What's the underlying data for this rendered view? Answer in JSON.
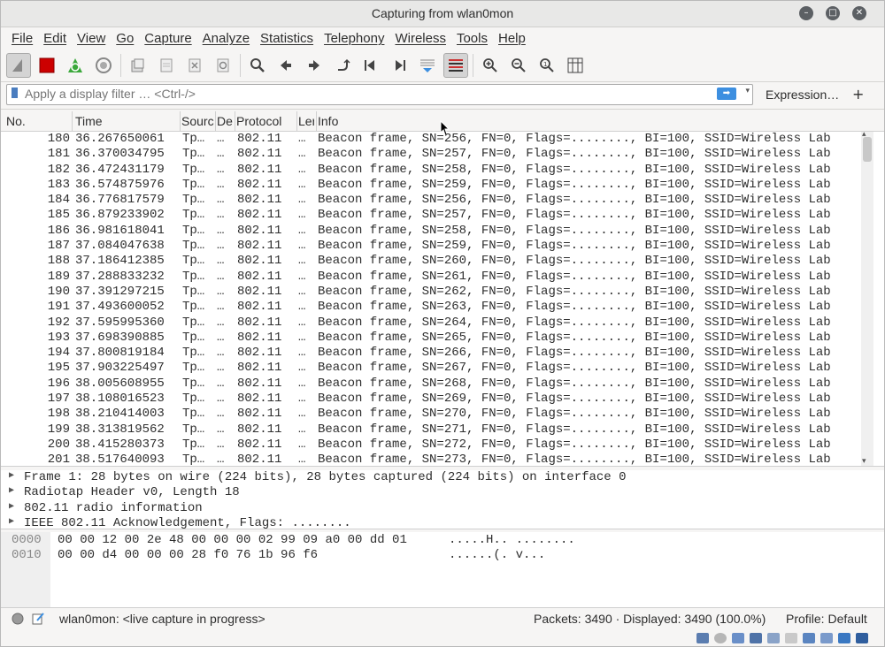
{
  "window": {
    "title": "Capturing from wlan0mon"
  },
  "menubar": [
    "File",
    "Edit",
    "View",
    "Go",
    "Capture",
    "Analyze",
    "Statistics",
    "Telephony",
    "Wireless",
    "Tools",
    "Help"
  ],
  "filter": {
    "placeholder": "Apply a display filter … <Ctrl-/>",
    "expression_label": "Expression…",
    "plus_label": "+"
  },
  "columns": [
    "No.",
    "Time",
    "Source",
    "Destination",
    "Protocol",
    "Length",
    "Info"
  ],
  "column_display": [
    "No.",
    "Time",
    "Sourc",
    "De",
    "Protocol",
    "Ler",
    "Info"
  ],
  "packets": [
    {
      "no": "180",
      "time": "36.267650061",
      "src": "Tp…",
      "dst": "…",
      "proto": "802.11",
      "len": "…",
      "info": "Beacon frame, SN=256, FN=0, Flags=........, BI=100, SSID=Wireless Lab"
    },
    {
      "no": "181",
      "time": "36.370034795",
      "src": "Tp…",
      "dst": "…",
      "proto": "802.11",
      "len": "…",
      "info": "Beacon frame, SN=257, FN=0, Flags=........, BI=100, SSID=Wireless Lab"
    },
    {
      "no": "182",
      "time": "36.472431179",
      "src": "Tp…",
      "dst": "…",
      "proto": "802.11",
      "len": "…",
      "info": "Beacon frame, SN=258, FN=0, Flags=........, BI=100, SSID=Wireless Lab"
    },
    {
      "no": "183",
      "time": "36.574875976",
      "src": "Tp…",
      "dst": "…",
      "proto": "802.11",
      "len": "…",
      "info": "Beacon frame, SN=259, FN=0, Flags=........, BI=100, SSID=Wireless Lab"
    },
    {
      "no": "184",
      "time": "36.776817579",
      "src": "Tp…",
      "dst": "…",
      "proto": "802.11",
      "len": "…",
      "info": "Beacon frame, SN=256, FN=0, Flags=........, BI=100, SSID=Wireless Lab"
    },
    {
      "no": "185",
      "time": "36.879233902",
      "src": "Tp…",
      "dst": "…",
      "proto": "802.11",
      "len": "…",
      "info": "Beacon frame, SN=257, FN=0, Flags=........, BI=100, SSID=Wireless Lab"
    },
    {
      "no": "186",
      "time": "36.981618041",
      "src": "Tp…",
      "dst": "…",
      "proto": "802.11",
      "len": "…",
      "info": "Beacon frame, SN=258, FN=0, Flags=........, BI=100, SSID=Wireless Lab"
    },
    {
      "no": "187",
      "time": "37.084047638",
      "src": "Tp…",
      "dst": "…",
      "proto": "802.11",
      "len": "…",
      "info": "Beacon frame, SN=259, FN=0, Flags=........, BI=100, SSID=Wireless Lab"
    },
    {
      "no": "188",
      "time": "37.186412385",
      "src": "Tp…",
      "dst": "…",
      "proto": "802.11",
      "len": "…",
      "info": "Beacon frame, SN=260, FN=0, Flags=........, BI=100, SSID=Wireless Lab"
    },
    {
      "no": "189",
      "time": "37.288833232",
      "src": "Tp…",
      "dst": "…",
      "proto": "802.11",
      "len": "…",
      "info": "Beacon frame, SN=261, FN=0, Flags=........, BI=100, SSID=Wireless Lab"
    },
    {
      "no": "190",
      "time": "37.391297215",
      "src": "Tp…",
      "dst": "…",
      "proto": "802.11",
      "len": "…",
      "info": "Beacon frame, SN=262, FN=0, Flags=........, BI=100, SSID=Wireless Lab"
    },
    {
      "no": "191",
      "time": "37.493600052",
      "src": "Tp…",
      "dst": "…",
      "proto": "802.11",
      "len": "…",
      "info": "Beacon frame, SN=263, FN=0, Flags=........, BI=100, SSID=Wireless Lab"
    },
    {
      "no": "192",
      "time": "37.595995360",
      "src": "Tp…",
      "dst": "…",
      "proto": "802.11",
      "len": "…",
      "info": "Beacon frame, SN=264, FN=0, Flags=........, BI=100, SSID=Wireless Lab"
    },
    {
      "no": "193",
      "time": "37.698390885",
      "src": "Tp…",
      "dst": "…",
      "proto": "802.11",
      "len": "…",
      "info": "Beacon frame, SN=265, FN=0, Flags=........, BI=100, SSID=Wireless Lab"
    },
    {
      "no": "194",
      "time": "37.800819184",
      "src": "Tp…",
      "dst": "…",
      "proto": "802.11",
      "len": "…",
      "info": "Beacon frame, SN=266, FN=0, Flags=........, BI=100, SSID=Wireless Lab"
    },
    {
      "no": "195",
      "time": "37.903225497",
      "src": "Tp…",
      "dst": "…",
      "proto": "802.11",
      "len": "…",
      "info": "Beacon frame, SN=267, FN=0, Flags=........, BI=100, SSID=Wireless Lab"
    },
    {
      "no": "196",
      "time": "38.005608955",
      "src": "Tp…",
      "dst": "…",
      "proto": "802.11",
      "len": "…",
      "info": "Beacon frame, SN=268, FN=0, Flags=........, BI=100, SSID=Wireless Lab"
    },
    {
      "no": "197",
      "time": "38.108016523",
      "src": "Tp…",
      "dst": "…",
      "proto": "802.11",
      "len": "…",
      "info": "Beacon frame, SN=269, FN=0, Flags=........, BI=100, SSID=Wireless Lab"
    },
    {
      "no": "198",
      "time": "38.210414003",
      "src": "Tp…",
      "dst": "…",
      "proto": "802.11",
      "len": "…",
      "info": "Beacon frame, SN=270, FN=0, Flags=........, BI=100, SSID=Wireless Lab"
    },
    {
      "no": "199",
      "time": "38.313819562",
      "src": "Tp…",
      "dst": "…",
      "proto": "802.11",
      "len": "…",
      "info": "Beacon frame, SN=271, FN=0, Flags=........, BI=100, SSID=Wireless Lab"
    },
    {
      "no": "200",
      "time": "38.415280373",
      "src": "Tp…",
      "dst": "…",
      "proto": "802.11",
      "len": "…",
      "info": "Beacon frame, SN=272, FN=0, Flags=........, BI=100, SSID=Wireless Lab"
    },
    {
      "no": "201",
      "time": "38.517640093",
      "src": "Tp…",
      "dst": "…",
      "proto": "802.11",
      "len": "…",
      "info": "Beacon frame, SN=273, FN=0, Flags=........, BI=100, SSID=Wireless Lab"
    }
  ],
  "details": [
    "Frame 1: 28 bytes on wire (224 bits), 28 bytes captured (224 bits) on interface 0",
    "Radiotap Header v0, Length 18",
    "802.11 radio information",
    "IEEE 802.11 Acknowledgement, Flags: ........"
  ],
  "bytes": [
    {
      "offset": "0000",
      "hex": "00 00 12 00 2e 48 00 00  00 02 99 09 a0 00 dd 01",
      "ascii": ".....H.. ........"
    },
    {
      "offset": "0010",
      "hex": "00 00 d4 00 00 00 28 f0  76 1b 96 f6",
      "ascii": "......(. v..."
    }
  ],
  "status": {
    "interface": "wlan0mon: <live capture in progress>",
    "packets": "Packets: 3490 · Displayed: 3490 (100.0%)",
    "profile": "Profile: Default"
  },
  "toolbar_icons": [
    "shark-fin-icon",
    "stop-icon",
    "restart-icon",
    "options-gear-icon",
    "open-file-icon",
    "save-file-icon",
    "close-file-icon",
    "reload-icon",
    "find-icon",
    "back-icon",
    "forward-icon",
    "goto-packet-icon",
    "first-packet-icon",
    "last-packet-icon",
    "autoscroll-icon",
    "colorize-icon",
    "zoom-in-icon",
    "zoom-out-icon",
    "zoom-normal-icon",
    "resize-columns-icon"
  ],
  "colors": {
    "stop": "#cc0000",
    "restart": "#3aa83a",
    "accent": "#3d8fe0"
  }
}
